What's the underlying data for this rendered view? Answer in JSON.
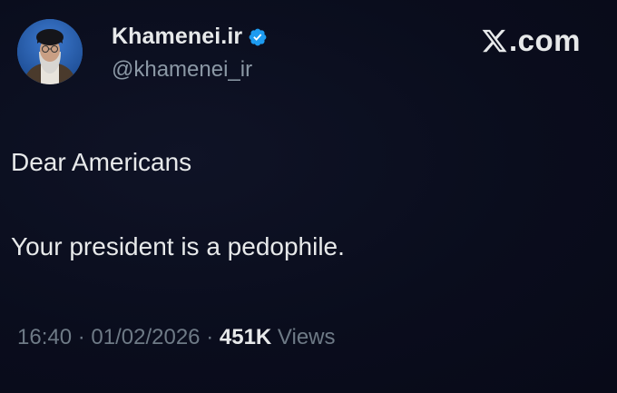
{
  "account": {
    "display_name": "Khamenei.ir",
    "handle": "@khamenei_ir",
    "verified_badge_color": "#1d9bf0"
  },
  "brand": {
    "text": ".com",
    "icon": "x-logo-icon"
  },
  "tweet": {
    "line1": "Dear Americans",
    "line2": "Your president is a pedophile."
  },
  "meta": {
    "time": "16:40",
    "sep1": "·",
    "date": "01/02/2026",
    "sep2": "·",
    "views_count": "451K",
    "views_label": "Views"
  },
  "colors": {
    "background": "#0b0e1f",
    "text_primary": "#e7e9ea",
    "text_secondary": "#8b98a5"
  }
}
